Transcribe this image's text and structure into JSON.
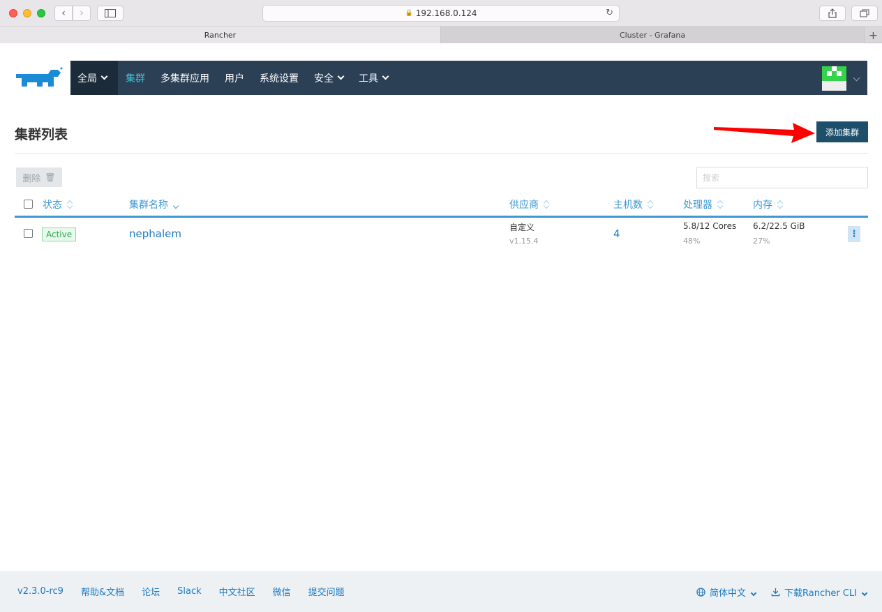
{
  "browser": {
    "url": "192.168.0.124",
    "tabs": [
      {
        "label": "Rancher"
      },
      {
        "label": "Cluster - Grafana"
      }
    ]
  },
  "nav": {
    "global_label": "全局",
    "items": [
      {
        "label": "集群"
      },
      {
        "label": "多集群应用"
      },
      {
        "label": "用户"
      },
      {
        "label": "系统设置"
      },
      {
        "label": "安全"
      },
      {
        "label": "工具"
      }
    ]
  },
  "page": {
    "title": "集群列表",
    "add_button": "添加集群",
    "delete_button": "删除",
    "search_placeholder": "搜索"
  },
  "table": {
    "headers": {
      "state": "状态",
      "name": "集群名称",
      "provider": "供应商",
      "nodes": "主机数",
      "cpu": "处理器",
      "memory": "内存"
    },
    "rows": [
      {
        "state": "Active",
        "name": "nephalem",
        "provider": "自定义",
        "version": "v1.15.4",
        "nodes": "4",
        "cpu": "5.8/12 Cores",
        "cpu_pct": "48%",
        "memory": "6.2/22.5 GiB",
        "memory_pct": "27%"
      }
    ]
  },
  "footer": {
    "version": "v2.3.0-rc9",
    "links": [
      {
        "label": "帮助&文档"
      },
      {
        "label": "论坛"
      },
      {
        "label": "Slack"
      },
      {
        "label": "中文社区"
      },
      {
        "label": "微信"
      },
      {
        "label": "提交问题"
      }
    ],
    "language": "简体中文",
    "download_cli": "下载Rancher CLI"
  },
  "colors": {
    "nav_bg": "#2b3f55",
    "nav_active": "#3dc6d9",
    "link": "#1c7ac0",
    "primary_button": "#1d4f6b",
    "active_badge": "#2fa74a",
    "annotation_arrow": "#ff0000"
  }
}
